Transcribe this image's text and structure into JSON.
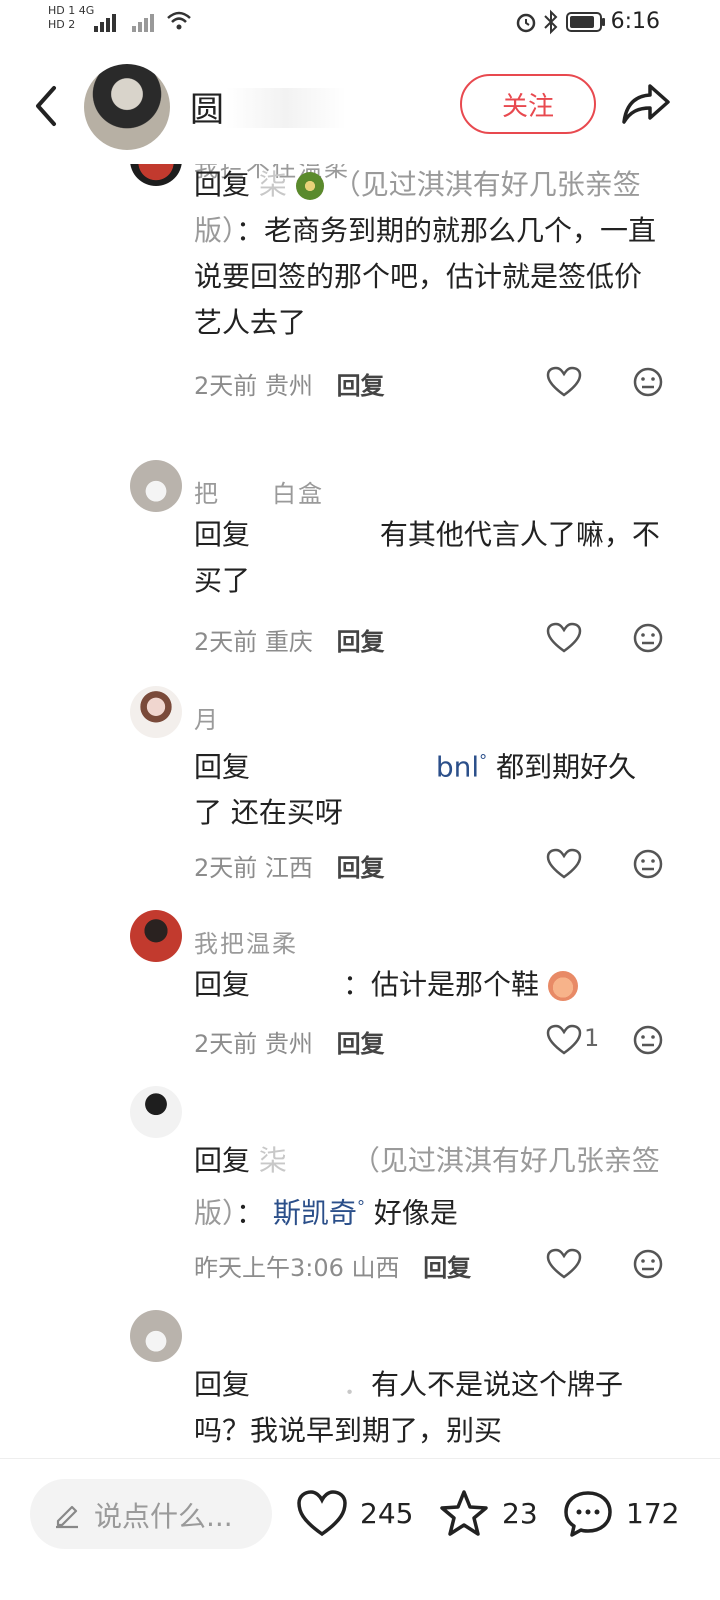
{
  "status_bar": {
    "left_line1": "HD 1  4G",
    "left_line2": "HD 2",
    "time": "6:16"
  },
  "header": {
    "author_name": "圆",
    "follow_label": "关注"
  },
  "comments": [
    {
      "name": "我拦不住温柔",
      "reply_prefix": "回复",
      "reply_to": "柒",
      "reply_to_note": "（见过淇淇有好几张亲签版）",
      "text": "：老商务到期的就那么几个，一直说要回签的那个吧，估计就是签低价艺人去了",
      "time": "2天前",
      "location": "贵州",
      "reply_label": "回复",
      "likes": ""
    },
    {
      "name": "把　　白盒",
      "reply_prefix": "回复",
      "reply_to": "",
      "text": "有其他代言人了嘛，不买了",
      "time": "2天前",
      "location": "重庆",
      "reply_label": "回复",
      "likes": ""
    },
    {
      "name": "月",
      "reply_prefix": "回复",
      "reply_to": "",
      "link": "bnl",
      "text": "都到期好久了 还在买呀",
      "time": "2天前",
      "location": "江西",
      "reply_label": "回复",
      "likes": ""
    },
    {
      "name": "我把温柔",
      "reply_prefix": "回复",
      "reply_to": "",
      "text": "：估计是那个鞋",
      "time": "2天前",
      "location": "贵州",
      "reply_label": "回复",
      "likes": "1"
    },
    {
      "name": "",
      "reply_prefix": "回复",
      "reply_to": "柒",
      "reply_to_note": "（见过淇淇有好几张亲签版）",
      "link": "斯凯奇",
      "text": "好像是",
      "time": "昨天上午3:06",
      "location": "山西",
      "reply_label": "回复",
      "likes": ""
    },
    {
      "name": "",
      "reply_prefix": "回复",
      "reply_to": "",
      "text": "有人不是说这个牌子吗？我说早到期了，别买",
      "time": "",
      "location": "",
      "reply_label": "",
      "likes": ""
    }
  ],
  "bottom_bar": {
    "input_placeholder": "说点什么...",
    "likes": "245",
    "favorites": "23",
    "comments": "172"
  },
  "colors": {
    "accent_red": "#e8494f",
    "link_blue": "#2b4f8a",
    "meta_gray": "#8c8c8c"
  },
  "icons": [
    "back-arrow-icon",
    "share-icon",
    "heart-icon",
    "emoji-icon",
    "pencil-icon",
    "star-icon",
    "comment-bubble-icon"
  ]
}
